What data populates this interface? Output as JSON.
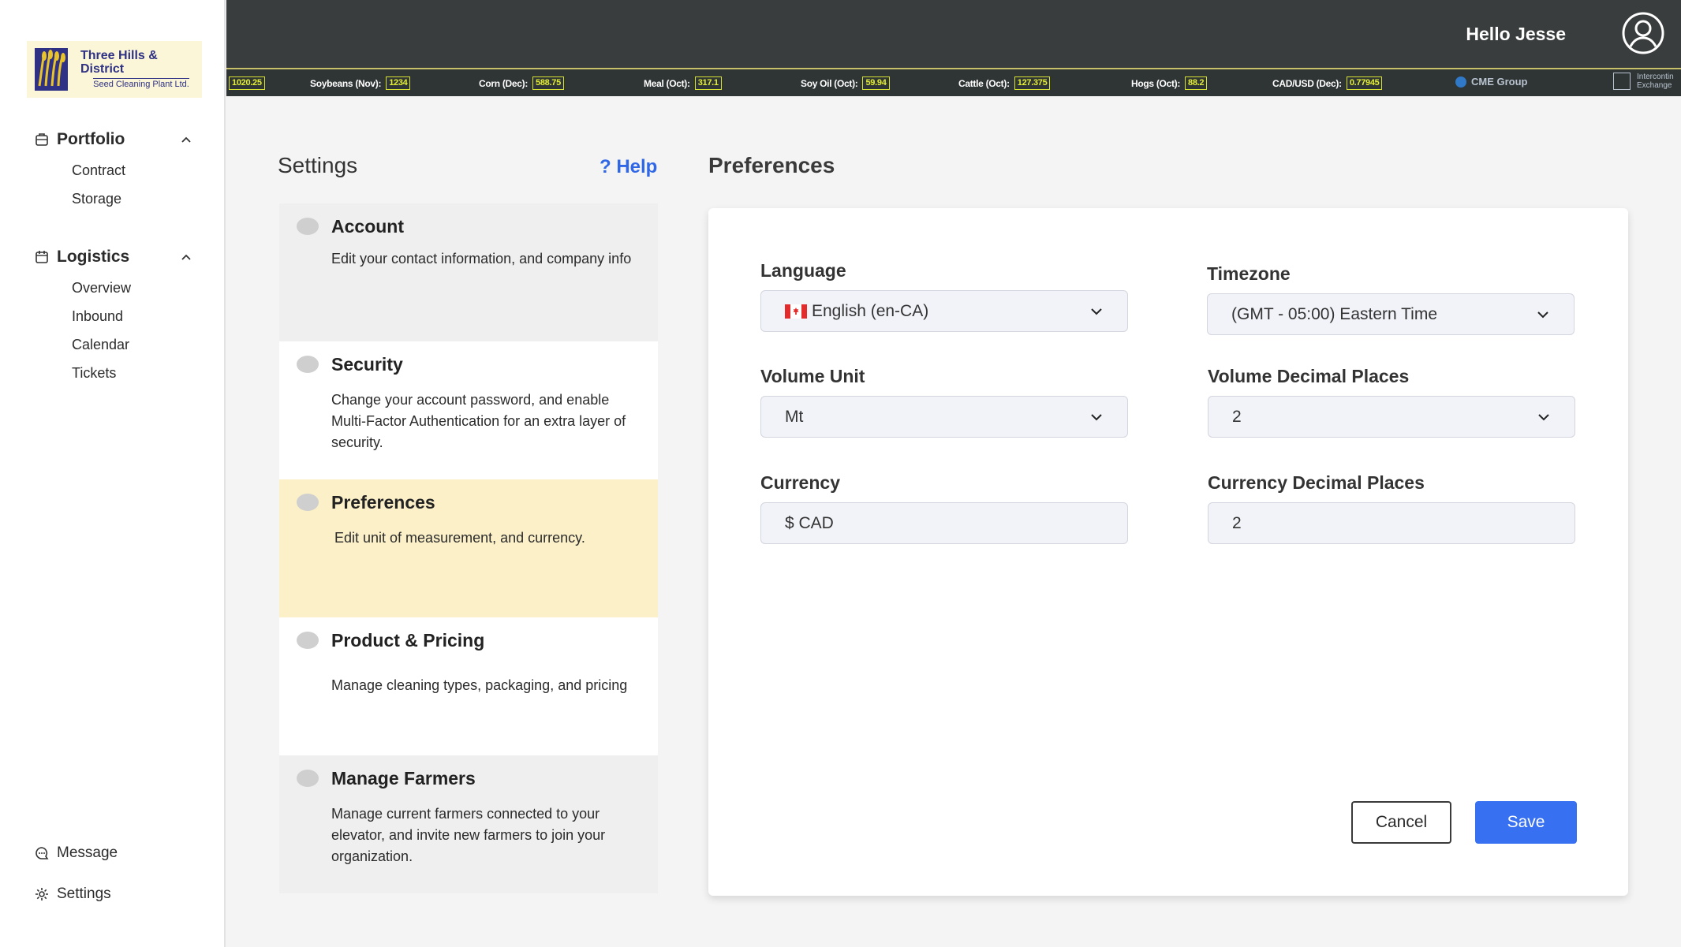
{
  "sidebar": {
    "logo": {
      "line1": "Three Hills & District",
      "line2": "Seed Cleaning Plant Ltd."
    },
    "groups": [
      {
        "label": "Portfolio",
        "icon": "briefcase-icon",
        "items": [
          "Contract",
          "Storage"
        ]
      },
      {
        "label": "Logistics",
        "icon": "calendar-icon",
        "items": [
          "Overview",
          "Inbound",
          "Calendar",
          "Tickets"
        ]
      }
    ],
    "bottom": {
      "message": "Message",
      "settings": "Settings"
    }
  },
  "header": {
    "greeting": "Hello Jesse"
  },
  "ticker": {
    "items": [
      {
        "label": "",
        "value": "1020.25"
      },
      {
        "label": "Soybeans (Nov):",
        "value": "1234"
      },
      {
        "label": "Corn (Dec):",
        "value": "588.75"
      },
      {
        "label": "Meal (Oct):",
        "value": "317.1"
      },
      {
        "label": "Soy Oil (Oct):",
        "value": "59.94"
      },
      {
        "label": "Cattle (Oct):",
        "value": "127.375"
      },
      {
        "label": "Hogs (Oct):",
        "value": "88.2"
      },
      {
        "label": "CAD/USD (Dec):",
        "value": "0.77945"
      }
    ],
    "cme": "CME Group",
    "ice_line1": "Intercontin",
    "ice_line2": "Exchange"
  },
  "settings": {
    "title": "Settings",
    "help": "? Help",
    "panels": [
      {
        "title": "Account",
        "desc": "Edit your contact information, and company info"
      },
      {
        "title": "Security",
        "desc": "Change your account password, and enable Multi-Factor Authentication for an extra layer of security."
      },
      {
        "title": "Preferences",
        "desc": "Edit unit of measurement, and currency."
      },
      {
        "title": "Product & Pricing",
        "desc": "Manage cleaning types, packaging, and pricing"
      },
      {
        "title": "Manage Farmers",
        "desc": "Manage current farmers connected to your elevator, and invite new farmers to join your organization."
      }
    ]
  },
  "preferences": {
    "title": "Preferences",
    "language": {
      "label": "Language",
      "value": "English (en-CA)"
    },
    "timezone": {
      "label": "Timezone",
      "value": "(GMT - 05:00) Eastern Time"
    },
    "volume_unit": {
      "label": "Volume Unit",
      "value": "Mt"
    },
    "volume_decimals": {
      "label": "Volume Decimal Places",
      "value": "2"
    },
    "currency": {
      "label": "Currency",
      "value": "$ CAD"
    },
    "currency_decimals": {
      "label": "Currency Decimal Places",
      "value": "2"
    },
    "cancel": "Cancel",
    "save": "Save"
  }
}
